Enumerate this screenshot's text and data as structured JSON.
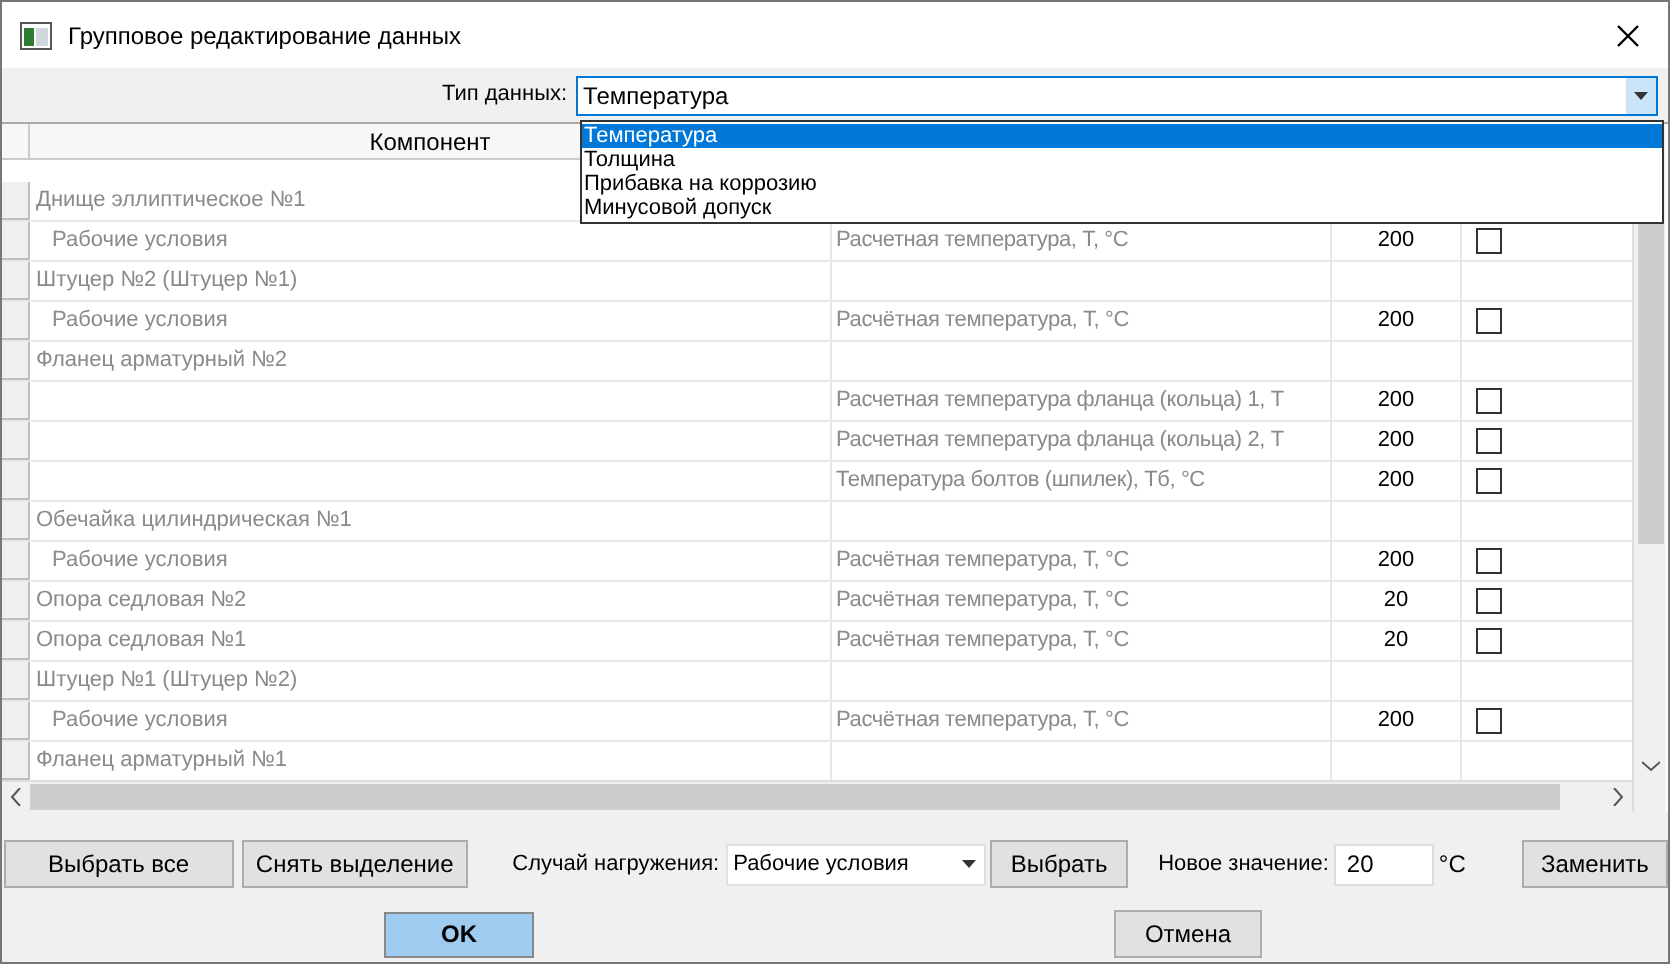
{
  "window": {
    "title": "Групповое редактирование данных"
  },
  "data_type": {
    "label": "Тип данных:",
    "value": "Температура",
    "expanded": true,
    "options": [
      {
        "label": "Температура",
        "selected": true
      },
      {
        "label": "Толщина",
        "selected": false
      },
      {
        "label": "Прибавка на коррозию",
        "selected": false
      },
      {
        "label": "Минусовой допуск",
        "selected": false
      }
    ]
  },
  "table": {
    "columns": [
      "Компонент"
    ],
    "rows": [
      {
        "component": "Днище эллиптическое №1",
        "children": [
          {
            "label": "Рабочие условия",
            "param": "Расчетная температура, T, °C",
            "value": "200",
            "checked": false
          }
        ]
      },
      {
        "component": "Штуцер №2 (Штуцер №1)",
        "children": [
          {
            "label": "Рабочие условия",
            "param": "Расчётная температура, T, °C",
            "value": "200",
            "checked": false
          }
        ]
      },
      {
        "component": "Фланец арматурный №2",
        "children": [
          {
            "param": "Расчетная температура фланца (кольца) 1, T",
            "value": "200",
            "checked": false
          },
          {
            "param": "Расчетная температура фланца (кольца) 2, T",
            "value": "200",
            "checked": false
          },
          {
            "param": "Температура болтов (шпилек), Tб, °C",
            "value": "200",
            "checked": false
          }
        ]
      },
      {
        "component": "Обечайка цилиндрическая №1",
        "children": [
          {
            "label": "Рабочие условия",
            "param": "Расчётная температура, T, °C",
            "value": "200",
            "checked": false
          }
        ]
      },
      {
        "component": "Опора седловая №2",
        "param": "Расчётная температура, T, °C",
        "value": "20",
        "checked": false
      },
      {
        "component": "Опора седловая №1",
        "param": "Расчётная температура, T, °C",
        "value": "20",
        "checked": false
      },
      {
        "component": "Штуцер №1 (Штуцер №2)",
        "children": [
          {
            "label": "Рабочие условия",
            "param": "Расчётная температура, T, °C",
            "value": "200",
            "checked": false
          }
        ]
      },
      {
        "component": "Фланец арматурный №1"
      }
    ]
  },
  "controls": {
    "select_all": "Выбрать все",
    "deselect": "Снять выделение",
    "load_case_label": "Случай нагружения:",
    "load_case": "Рабочие условия",
    "choose": "Выбрать",
    "new_value_label": "Новое значение:",
    "new_value": "20",
    "unit": "°C",
    "replace": "Заменить"
  },
  "buttons": {
    "ok": "OK",
    "cancel": "Отмена"
  }
}
